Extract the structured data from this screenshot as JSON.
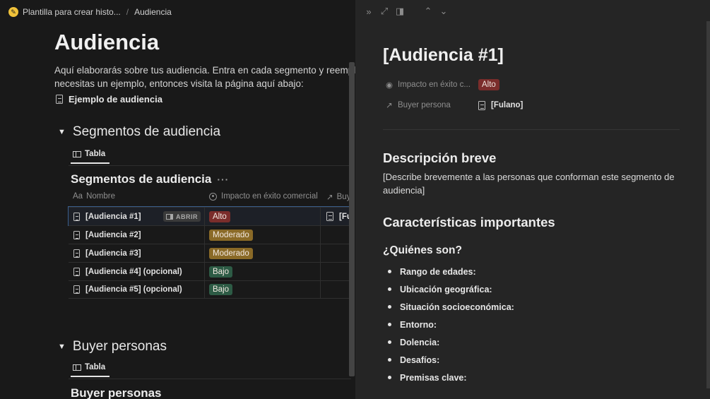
{
  "breadcrumb": {
    "workspace": "Plantilla para crear histo...",
    "separator": "/",
    "page": "Audiencia"
  },
  "page": {
    "title": "Audiencia",
    "intro_line1": "Aquí elaborarás sobre tus audiencia. Entra en cada segmento y reemplaza e",
    "intro_line2": "necesitas un ejemplo, entonces visita la página aquí abajo:",
    "example_link": "Ejemplo de audiencia"
  },
  "segmentos": {
    "toggle_title": "Segmentos de audiencia",
    "view_tab": "Tabla",
    "db_title": "Segmentos de audiencia",
    "db_menu": "···",
    "columns": {
      "nombre": "Nombre",
      "nombre_prefix": "Aa",
      "impacto": "Impacto en éxito comercial",
      "buyer": "Buy"
    },
    "open_label": "ABRIR",
    "rows": [
      {
        "name": "[Audiencia #1]",
        "impacto": "Alto",
        "buyer": "[Fu"
      },
      {
        "name": "[Audiencia #2]",
        "impacto": "Moderado",
        "buyer": ""
      },
      {
        "name": "[Audiencia #3]",
        "impacto": "Moderado",
        "buyer": ""
      },
      {
        "name": "[Audiencia #4] (opcional)",
        "impacto": "Bajo",
        "buyer": ""
      },
      {
        "name": "[Audiencia #5] (opcional)",
        "impacto": "Bajo",
        "buyer": ""
      }
    ]
  },
  "buyer": {
    "toggle_title": "Buyer personas",
    "view_tab": "Tabla",
    "db_title": "Buyer personas"
  },
  "peek": {
    "title": "[Audiencia #1]",
    "prop_impacto_label": "Impacto en éxito c...",
    "prop_impacto_value": "Alto",
    "prop_buyer_label": "Buyer persona",
    "prop_buyer_value": "[Fulano]",
    "desc_heading": "Descripción breve",
    "desc_body": "[Describe brevemente a las personas que conforman este segmento de audiencia]",
    "car_heading": "Características importantes",
    "quienes_heading": "¿Quiénes son?",
    "bullets": [
      "Rango de edades:",
      "Ubicación geográfica:",
      "Situación socioeconómica:",
      "Entorno:",
      "Dolencia:",
      "Desafíos:",
      "Premisas clave:"
    ]
  },
  "colors": {
    "alto": "#7b2d2b",
    "moderado": "#8a6a27",
    "bajo": "#2d5b45"
  }
}
